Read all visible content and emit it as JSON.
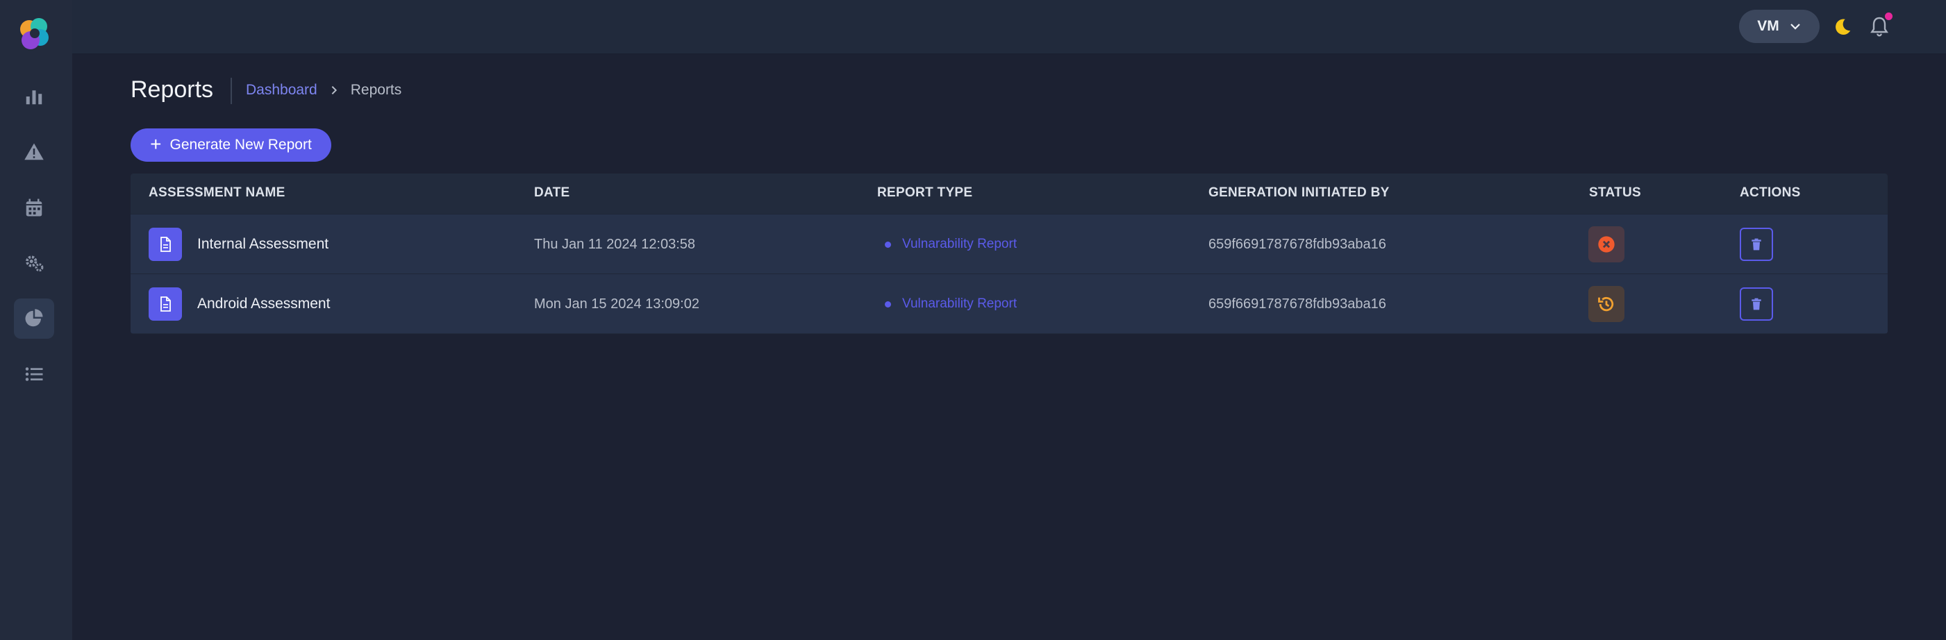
{
  "colors": {
    "accent": "#5b5bea",
    "background": "#1c2132",
    "sidebar": "#232b3d",
    "status_failed": "#f05a2e",
    "status_pending": "#f0a030",
    "notification_dot": "#e6289b",
    "moon": "#f5c518"
  },
  "sidebar": {
    "items": [
      {
        "icon": "bar-chart-icon"
      },
      {
        "icon": "warning-icon"
      },
      {
        "icon": "calendar-icon"
      },
      {
        "icon": "gears-icon"
      },
      {
        "icon": "pie-chart-icon",
        "active": true
      },
      {
        "icon": "list-icon"
      }
    ]
  },
  "header": {
    "user_initials": "VM",
    "user_menu_icon": "chevron-down-icon",
    "theme_icon": "moon-icon",
    "notifications_icon": "bell-icon"
  },
  "page": {
    "title": "Reports",
    "breadcrumb": [
      {
        "label": "Dashboard"
      },
      {
        "label": "Reports"
      }
    ]
  },
  "toolbar": {
    "generate_label": "Generate New Report"
  },
  "table": {
    "columns": [
      "ASSESSMENT NAME",
      "DATE",
      "REPORT TYPE",
      "GENERATION INITIATED BY",
      "STATUS",
      "ACTIONS"
    ],
    "rows": [
      {
        "name": "Internal Assessment",
        "date": "Thu Jan 11 2024 12:03:58",
        "type": "Vulnarability Report",
        "initiated_by": "659f6691787678fdb93aba16",
        "status_icon": "failed-x-icon"
      },
      {
        "name": "Android Assessment",
        "date": "Mon Jan 15 2024 13:09:02",
        "type": "Vulnarability Report",
        "initiated_by": "659f6691787678fdb93aba16",
        "status_icon": "history-clock-icon"
      }
    ]
  }
}
